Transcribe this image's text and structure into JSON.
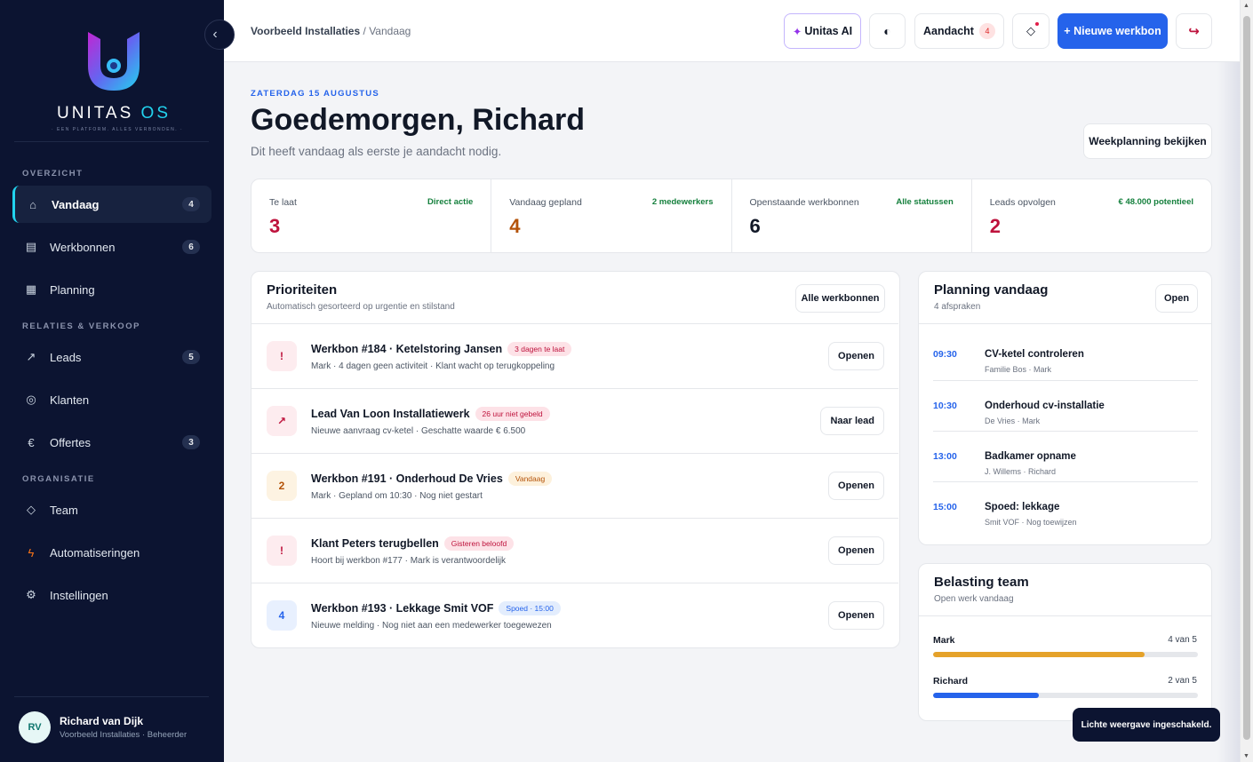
{
  "sidebar": {
    "brand": "UNITAS",
    "brand_os": "OS",
    "tagline": "· EEN PLATFORM. ALLES VERBONDEN. ·",
    "collapse_icon": "chevron-left-icon",
    "sections": {
      "overview": "OVERZICHT",
      "relations": "RELATIES & VERKOOP",
      "organisation": "ORGANISATIE"
    },
    "items": [
      {
        "label": "Vandaag",
        "count": "4",
        "icon": "home-icon"
      },
      {
        "label": "Werkbonnen",
        "count": "6",
        "icon": "document-icon"
      },
      {
        "label": "Planning",
        "icon": "calendar-grid-icon"
      },
      {
        "label": "Leads",
        "count": "5",
        "icon": "arrow-up-right-icon"
      },
      {
        "label": "Klanten",
        "icon": "target-icon"
      },
      {
        "label": "Offertes",
        "count": "3",
        "icon": "euro-icon"
      },
      {
        "label": "Team",
        "icon": "diamond-icon"
      },
      {
        "label": "Automatiseringen",
        "icon": "bolt-icon"
      },
      {
        "label": "Instellingen",
        "icon": "gear-icon"
      }
    ],
    "user": {
      "initials": "RV",
      "name": "Richard van Dijk",
      "role": "Voorbeeld Installaties · Beheerder"
    }
  },
  "topbar": {
    "breadcrumb_company": "Voorbeeld Installaties",
    "breadcrumb_sep": "/",
    "breadcrumb_page": "Vandaag",
    "ai_label": "Unitas AI",
    "ai_icon": "sparkle-icon",
    "theme_icon": "half-circle-icon",
    "attention_label": "Aandacht",
    "attention_count": "4",
    "diamond_icon": "diamond-notification-icon",
    "new_label": "+ Nieuwe werkbon",
    "logout_icon": "logout-arrow-icon"
  },
  "header": {
    "date": "ZATERDAG 15 AUGUSTUS",
    "greeting": "Goedemorgen, Richard",
    "subtitle": "Dit heeft vandaag als eerste je aandacht nodig.",
    "week_button": "Weekplanning bekijken"
  },
  "stats": [
    {
      "label": "Te laat",
      "action": "Direct actie",
      "value": "3",
      "color": "#be123c"
    },
    {
      "label": "Vandaag gepland",
      "action": "2 medewerkers",
      "value": "4",
      "color": "#b45309"
    },
    {
      "label": "Openstaande werkbonnen",
      "action": "Alle statussen",
      "value": "6",
      "color": "#111827"
    },
    {
      "label": "Leads opvolgen",
      "action": "€ 48.000 potentieel",
      "value": "2",
      "color": "#be123c"
    }
  ],
  "priorities": {
    "title": "Prioriteiten",
    "subtitle": "Automatisch gesorteerd op urgentie en stilstand",
    "button": "Alle werkbonnen",
    "rows": [
      {
        "icon": "!",
        "title": "Werkbon #184 · Ketelstoring Jansen",
        "tag": "3 dagen te laat",
        "meta": "Mark · 4 dagen geen activiteit · Klant wacht op terugkoppeling",
        "button": "Openen"
      },
      {
        "icon": "↗",
        "title": "Lead Van Loon Installatiewerk",
        "tag": "26 uur niet gebeld",
        "meta": "Nieuwe aanvraag cv-ketel · Geschatte waarde € 6.500",
        "button": "Naar lead"
      },
      {
        "icon": "2",
        "title": "Werkbon #191 · Onderhoud De Vries",
        "tag": "Vandaag",
        "meta": "Mark · Gepland om 10:30 · Nog niet gestart",
        "button": "Openen"
      },
      {
        "icon": "!",
        "title": "Klant Peters terugbellen",
        "tag": "Gisteren beloofd",
        "meta": "Hoort bij werkbon #177 · Mark is verantwoordelijk",
        "button": "Openen"
      },
      {
        "icon": "4",
        "title": "Werkbon #193 · Lekkage Smit VOF",
        "tag": "Spoed · 15:00",
        "meta": "Nieuwe melding · Nog niet aan een medewerker toegewezen",
        "button": "Openen"
      }
    ]
  },
  "planning": {
    "title": "Planning vandaag",
    "subtitle": "4 afspraken",
    "button": "Open",
    "slots": [
      {
        "time": "09:30",
        "title": "CV-ketel controleren",
        "meta": "Familie Bos · Mark"
      },
      {
        "time": "10:30",
        "title": "Onderhoud cv-installatie",
        "meta": "De Vries · Mark"
      },
      {
        "time": "13:00",
        "title": "Badkamer opname",
        "meta": "J. Willems · Richard"
      },
      {
        "time": "15:00",
        "title": "Spoed: lekkage",
        "meta": "Smit VOF · Nog toewijzen"
      }
    ]
  },
  "load": {
    "title": "Belasting team",
    "subtitle": "Open werk vandaag",
    "members": [
      {
        "name": "Mark",
        "value": "4 van 5",
        "level": 0.8,
        "color": "#e5a22a"
      },
      {
        "name": "Richard",
        "value": "2 van 5",
        "level": 0.4,
        "color": "#2563eb"
      }
    ]
  },
  "toast": "Lichte weergave ingeschakeld."
}
